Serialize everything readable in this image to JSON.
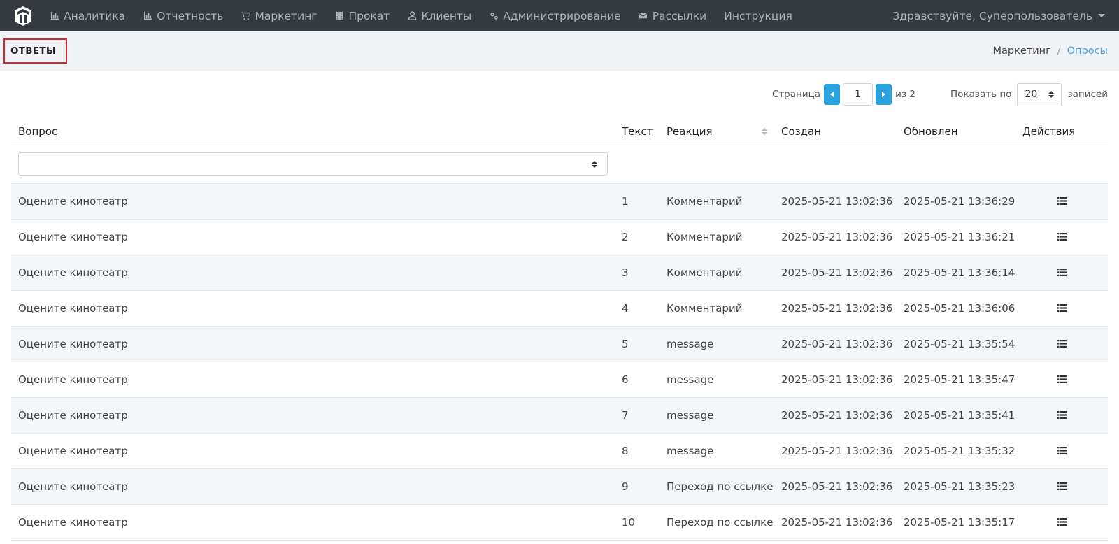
{
  "nav": {
    "items": [
      {
        "label": "Аналитика",
        "icon": "bar-chart-icon"
      },
      {
        "label": "Отчетность",
        "icon": "bar-chart-icon"
      },
      {
        "label": "Маркетинг",
        "icon": "cart-icon"
      },
      {
        "label": "Прокат",
        "icon": "film-icon"
      },
      {
        "label": "Клиенты",
        "icon": "user-icon"
      },
      {
        "label": "Администрирование",
        "icon": "gears-icon"
      },
      {
        "label": "Рассылки",
        "icon": "envelope-icon"
      },
      {
        "label": "Инструкция",
        "icon": ""
      }
    ],
    "user_greeting": "Здравствуйте, Суперпользователь"
  },
  "page": {
    "title": "ОТВЕТЫ",
    "breadcrumb": [
      "Маркетинг",
      "Опросы"
    ],
    "breadcrumb_sep": "/"
  },
  "pager": {
    "page_label": "Страница",
    "page_value": "1",
    "of_label": "из 2",
    "show_label": "Показать по",
    "page_size": "20",
    "records_label": "записей"
  },
  "table": {
    "headers": [
      "Вопрос",
      "Текст",
      "Реакция",
      "Создан",
      "Обновлен",
      "Действия"
    ],
    "rows": [
      [
        "Оцените кинотеатр",
        "1",
        "Комментарий",
        "2025-05-21 13:02:36",
        "2025-05-21 13:36:29"
      ],
      [
        "Оцените кинотеатр",
        "2",
        "Комментарий",
        "2025-05-21 13:02:36",
        "2025-05-21 13:36:21"
      ],
      [
        "Оцените кинотеатр",
        "3",
        "Комментарий",
        "2025-05-21 13:02:36",
        "2025-05-21 13:36:14"
      ],
      [
        "Оцените кинотеатр",
        "4",
        "Комментарий",
        "2025-05-21 13:02:36",
        "2025-05-21 13:36:06"
      ],
      [
        "Оцените кинотеатр",
        "5",
        "message",
        "2025-05-21 13:02:36",
        "2025-05-21 13:35:54"
      ],
      [
        "Оцените кинотеатр",
        "6",
        "message",
        "2025-05-21 13:02:36",
        "2025-05-21 13:35:47"
      ],
      [
        "Оцените кинотеатр",
        "7",
        "message",
        "2025-05-21 13:02:36",
        "2025-05-21 13:35:41"
      ],
      [
        "Оцените кинотеатр",
        "8",
        "message",
        "2025-05-21 13:02:36",
        "2025-05-21 13:35:32"
      ],
      [
        "Оцените кинотеатр",
        "9",
        "Переход по ссылке",
        "2025-05-21 13:02:36",
        "2025-05-21 13:35:23"
      ],
      [
        "Оцените кинотеатр",
        "10",
        "Переход по ссылке",
        "2025-05-21 13:02:36",
        "2025-05-21 13:35:17"
      ]
    ]
  },
  "colors": {
    "navbar_bg": "#343a40",
    "accent": "#29a3e0",
    "title_border": "#d9232d",
    "stripe": "#f4f7fa"
  }
}
